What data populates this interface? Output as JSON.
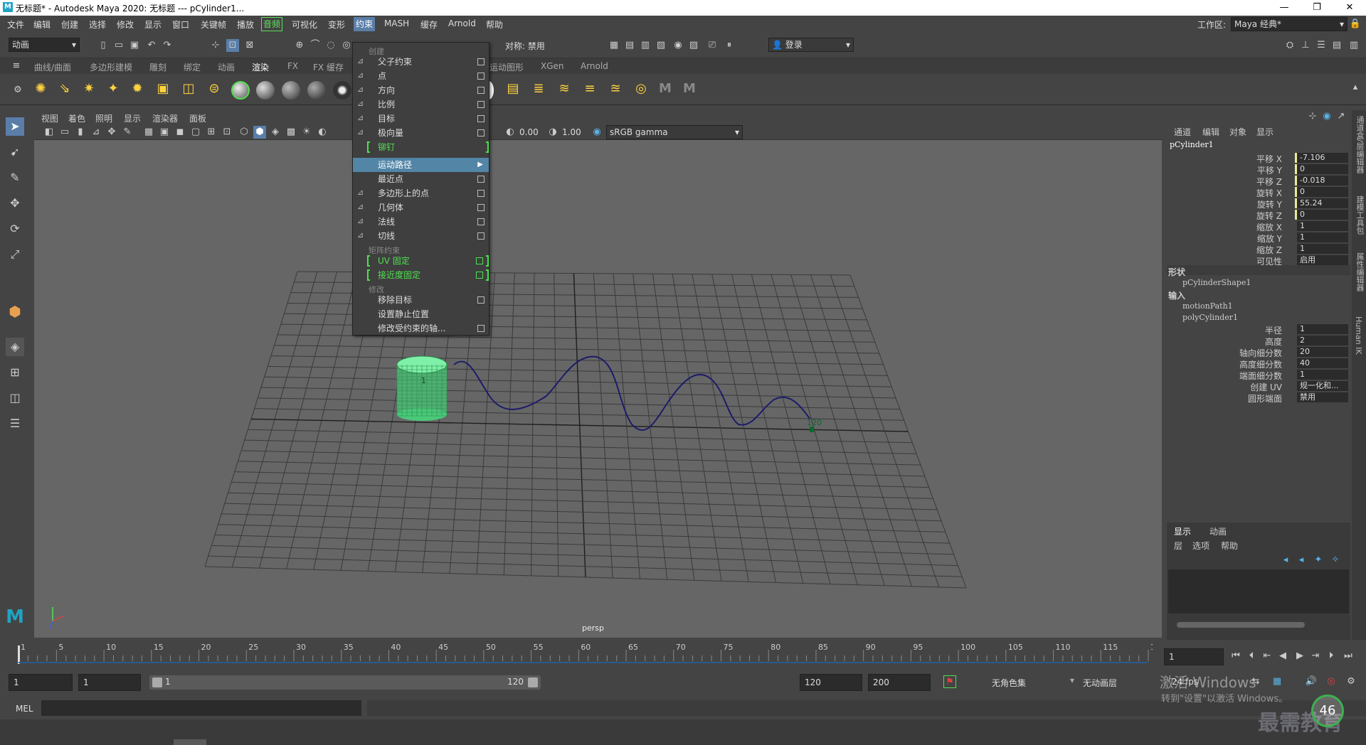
{
  "window": {
    "title": "无标题* - Autodesk Maya 2020: 无标题   ---   pCylinder1...",
    "minimize": "—",
    "restore": "❐",
    "close": "✕"
  },
  "menubar": {
    "items": [
      "文件",
      "编辑",
      "创建",
      "选择",
      "修改",
      "显示",
      "窗口",
      "关键帧",
      "播放",
      "音频",
      "可视化",
      "变形",
      "约束",
      "MASH",
      "缓存",
      "Arnold",
      "帮助"
    ],
    "workspace_label": "工作区:",
    "workspace_value": "Maya 经典*"
  },
  "toolbar": {
    "mode_value": "动画",
    "symmetry": "对称: 禁用",
    "login": "登录"
  },
  "shelf": {
    "tabs": [
      "曲线/曲面",
      "多边形建模",
      "雕刻",
      "绑定",
      "动画",
      "渲染",
      "FX",
      "FX 缓存",
      "运动图形",
      "XGen",
      "Arnold"
    ],
    "active_tab": "渲染"
  },
  "viewport": {
    "menus": [
      "视图",
      "着色",
      "照明",
      "显示",
      "渲染器",
      "面板"
    ],
    "exposure": "0.00",
    "gamma": "1.00",
    "colorspace": "sRGB gamma",
    "camera_label": "persp",
    "frame_marker": "120",
    "object_index": "1"
  },
  "constrain_menu": {
    "section_create": "创建",
    "items": [
      "父子约束",
      "点",
      "方向",
      "比例",
      "目标",
      "极向量",
      "铆钉",
      "运动路径",
      "最近点",
      "多边形上的点",
      "几何体",
      "法线",
      "切线"
    ],
    "section_matrix": "矩阵约束",
    "matrix_items": [
      "UV 固定",
      "接近度固定"
    ],
    "section_modify": "修改",
    "modify_items": [
      "移除目标",
      "设置静止位置",
      "修改受约束的轴..."
    ]
  },
  "channelbox": {
    "tabs": [
      "通道",
      "编辑",
      "对象",
      "显示"
    ],
    "object": "pCylinder1",
    "attrs": [
      {
        "label": "平移 X",
        "value": "-7.106",
        "key": true
      },
      {
        "label": "平移 Y",
        "value": "0",
        "key": true
      },
      {
        "label": "平移 Z",
        "value": "-0.018",
        "key": true
      },
      {
        "label": "旋转 X",
        "value": "0",
        "key": true
      },
      {
        "label": "旋转 Y",
        "value": "55.24",
        "key": true
      },
      {
        "label": "旋转 Z",
        "value": "0",
        "key": true
      },
      {
        "label": "缩放 X",
        "value": "1",
        "key": false
      },
      {
        "label": "缩放 Y",
        "value": "1",
        "key": false
      },
      {
        "label": "缩放 Z",
        "value": "1",
        "key": false
      },
      {
        "label": "可见性",
        "value": "启用",
        "key": false
      }
    ],
    "shape_header": "形状",
    "shape_name": "pCylinderShape1",
    "input_header": "输入",
    "inputs": [
      "motionPath1",
      "polyCylinder1"
    ],
    "poly_attrs": [
      {
        "label": "半径",
        "value": "1"
      },
      {
        "label": "高度",
        "value": "2"
      },
      {
        "label": "轴向细分数",
        "value": "20"
      },
      {
        "label": "高度细分数",
        "value": "40"
      },
      {
        "label": "端面细分数",
        "value": "1"
      },
      {
        "label": "创建 UV",
        "value": "规一化和..."
      },
      {
        "label": "圆形端面",
        "value": "禁用"
      }
    ]
  },
  "layers": {
    "tabs": [
      "显示",
      "动画"
    ],
    "menus": [
      "层",
      "选项",
      "帮助"
    ]
  },
  "sidetabs": [
    "通道盒/层编辑器",
    "建模工具包",
    "属性编辑器",
    "Human IK"
  ],
  "timeline": {
    "ticks": [
      "1",
      "5",
      "10",
      "15",
      "20",
      "25",
      "30",
      "35",
      "40",
      "45",
      "50",
      "55",
      "60",
      "65",
      "70",
      "75",
      "80",
      "85",
      "90",
      "95",
      "100",
      "105",
      "110",
      "115",
      "120"
    ],
    "current_frame": "1"
  },
  "range": {
    "start": "1",
    "playback_start": "1",
    "slider_start": "1",
    "slider_end": "120",
    "playback_end": "120",
    "end": "200",
    "char_set": "无角色集",
    "anim_layer": "无动画层",
    "fps": "24 fps"
  },
  "mel": {
    "label": "MEL"
  },
  "watermark": {
    "activate_title": "激活 Windows",
    "activate_sub": "转到\"设置\"以激活 Windows。",
    "brand": "最需教育",
    "badge": "46"
  }
}
